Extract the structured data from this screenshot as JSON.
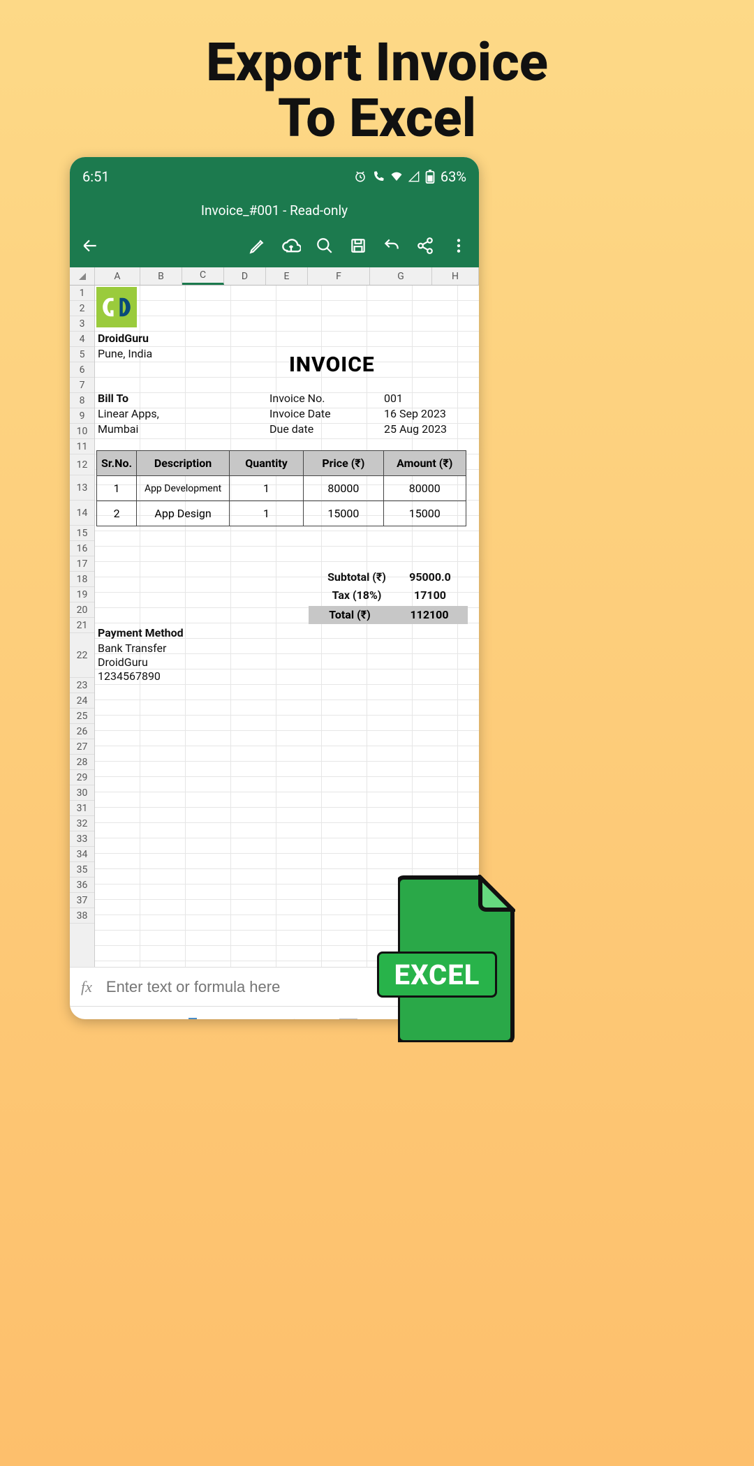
{
  "headline_line1": "Export Invoice",
  "headline_line2": "To Excel",
  "status": {
    "time": "6:51",
    "battery": "63%"
  },
  "doc_title": "Invoice_#001 - Read-only",
  "columns": [
    "A",
    "B",
    "C",
    "D",
    "E",
    "F",
    "G",
    "H"
  ],
  "rows": 38,
  "company": {
    "name": "DroidGuru",
    "location": "Pune, India"
  },
  "invoice_heading": "INVOICE",
  "bill_to": {
    "label": "Bill To",
    "name": "Linear Apps,",
    "city": "Mumbai"
  },
  "meta": {
    "no_label": "Invoice No.",
    "no": "001",
    "date_label": "Invoice Date",
    "date": "16 Sep 2023",
    "due_label": "Due date",
    "due": "25 Aug 2023"
  },
  "table": {
    "headers": {
      "sr": "Sr.No.",
      "desc": "Description",
      "qty": "Quantity",
      "price": "Price (₹)",
      "amt": "Amount (₹)"
    },
    "rows": [
      {
        "sr": "1",
        "desc": "App Development",
        "qty": "1",
        "price": "80000",
        "amt": "80000"
      },
      {
        "sr": "2",
        "desc": "App Design",
        "qty": "1",
        "price": "15000",
        "amt": "15000"
      }
    ]
  },
  "summary": {
    "subtotal_label": "Subtotal (₹)",
    "subtotal": "95000.0",
    "tax_label": "Tax (18%)",
    "tax": "17100",
    "total_label": "Total (₹)",
    "total": "112100"
  },
  "payment": {
    "label": "Payment Method",
    "method": "Bank Transfer",
    "payee": "DroidGuru",
    "account": "1234567890"
  },
  "formula_placeholder": "Enter text or formula here",
  "excel_badge": "EXCEL",
  "chart_data": {
    "type": "table",
    "title": "Invoice_#001",
    "columns": [
      "Sr.No.",
      "Description",
      "Quantity",
      "Price (₹)",
      "Amount (₹)"
    ],
    "rows": [
      [
        1,
        "App Development",
        1,
        80000,
        80000
      ],
      [
        2,
        "App Design",
        1,
        15000,
        15000
      ]
    ],
    "summary": {
      "Subtotal (₹)": 95000.0,
      "Tax (18%)": 17100,
      "Total (₹)": 112100
    }
  }
}
